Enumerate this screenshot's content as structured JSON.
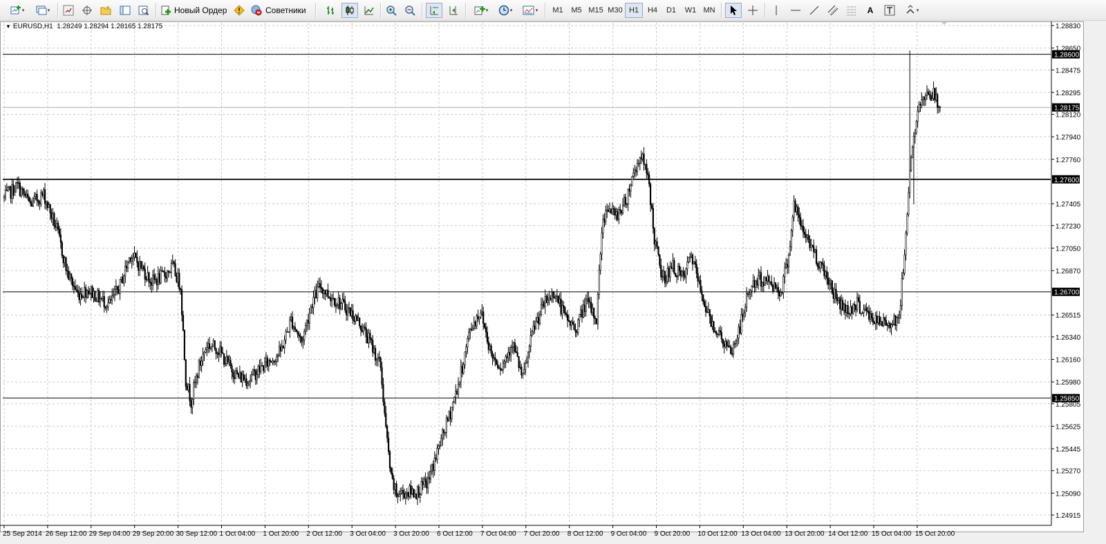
{
  "symbol_info": {
    "caret": "▼",
    "symbol": "EURUSD,H1",
    "ohlc": "1.28249 1.28294 1.28165 1.28175"
  },
  "toolbar": {
    "new_order_label": "Новый Ордер",
    "experts_label": "Советники",
    "timeframes": [
      "M1",
      "M5",
      "M15",
      "M30",
      "H1",
      "H4",
      "D1",
      "W1",
      "MN"
    ],
    "active_timeframe": "H1",
    "text_tool_label": "A",
    "dropdown_glyph": "▾"
  },
  "price_axis": {
    "ticks": [
      "1.28830",
      "1.28650",
      "1.28475",
      "1.28295",
      "1.28120",
      "1.27940",
      "1.27760",
      "1.27405",
      "1.27230",
      "1.27050",
      "1.26870",
      "1.26515",
      "1.26340",
      "1.26160",
      "1.25980",
      "1.25805",
      "1.25625",
      "1.25445",
      "1.25270",
      "1.25090",
      "1.24915"
    ],
    "labels": [
      "1.28600",
      "1.28175",
      "1.27600",
      "1.26700",
      "1.25850"
    ]
  },
  "time_axis": {
    "ticks": [
      "25 Sep 2014",
      "26 Sep 12:00",
      "29 Sep 04:00",
      "29 Sep 20:00",
      "30 Sep 12:00",
      "1 Oct 04:00",
      "1 Oct 20:00",
      "2 Oct 12:00",
      "3 Oct 04:00",
      "3 Oct 20:00",
      "6 Oct 12:00",
      "7 Oct 04:00",
      "7 Oct 20:00",
      "8 Oct 12:00",
      "9 Oct 04:00",
      "9 Oct 20:00",
      "10 Oct 12:00",
      "13 Oct 04:00",
      "13 Oct 20:00",
      "14 Oct 12:00",
      "15 Oct 04:00",
      "15 Oct 20:00"
    ]
  },
  "chart_data": {
    "type": "candlestick",
    "symbol": "EURUSD",
    "timeframe": "H1",
    "ylim": [
      1.24915,
      1.2883
    ],
    "horizontal_levels": [
      1.286,
      1.276,
      1.267,
      1.2585
    ],
    "last_price": 1.28175,
    "close_path": [
      [
        0,
        1.2745
      ],
      [
        10,
        1.2755
      ],
      [
        20,
        1.274
      ],
      [
        30,
        1.2748
      ],
      [
        40,
        1.272
      ],
      [
        48,
        1.2685
      ],
      [
        56,
        1.2668
      ],
      [
        64,
        1.2672
      ],
      [
        72,
        1.2665
      ],
      [
        80,
        1.266
      ],
      [
        88,
        1.2675
      ],
      [
        96,
        1.27
      ],
      [
        104,
        1.269
      ],
      [
        112,
        1.2678
      ],
      [
        120,
        1.2682
      ],
      [
        128,
        1.269
      ],
      [
        134,
        1.2675
      ],
      [
        138,
        1.26
      ],
      [
        142,
        1.2583
      ],
      [
        148,
        1.261
      ],
      [
        154,
        1.2628
      ],
      [
        162,
        1.2625
      ],
      [
        170,
        1.2612
      ],
      [
        178,
        1.2602
      ],
      [
        186,
        1.26
      ],
      [
        194,
        1.2608
      ],
      [
        202,
        1.2615
      ],
      [
        210,
        1.2622
      ],
      [
        218,
        1.2648
      ],
      [
        226,
        1.263
      ],
      [
        234,
        1.2662
      ],
      [
        240,
        1.2675
      ],
      [
        246,
        1.2668
      ],
      [
        254,
        1.2662
      ],
      [
        262,
        1.2655
      ],
      [
        270,
        1.2645
      ],
      [
        278,
        1.263
      ],
      [
        286,
        1.261
      ],
      [
        290,
        1.256
      ],
      [
        294,
        1.252
      ],
      [
        298,
        1.2508
      ],
      [
        306,
        1.251
      ],
      [
        314,
        1.251
      ],
      [
        322,
        1.2518
      ],
      [
        330,
        1.2545
      ],
      [
        338,
        1.257
      ],
      [
        346,
        1.26
      ],
      [
        354,
        1.264
      ],
      [
        362,
        1.2655
      ],
      [
        370,
        1.262
      ],
      [
        378,
        1.261
      ],
      [
        386,
        1.263
      ],
      [
        394,
        1.26
      ],
      [
        402,
        1.264
      ],
      [
        410,
        1.266
      ],
      [
        418,
        1.267
      ],
      [
        426,
        1.265
      ],
      [
        434,
        1.264
      ],
      [
        442,
        1.2662
      ],
      [
        450,
        1.2648
      ],
      [
        454,
        1.272
      ],
      [
        458,
        1.274
      ],
      [
        464,
        1.273
      ],
      [
        472,
        1.2742
      ],
      [
        478,
        1.2765
      ],
      [
        484,
        1.278
      ],
      [
        490,
        1.2755
      ],
      [
        494,
        1.2712
      ],
      [
        500,
        1.268
      ],
      [
        508,
        1.269
      ],
      [
        516,
        1.268
      ],
      [
        522,
        1.27
      ],
      [
        528,
        1.2675
      ],
      [
        536,
        1.2648
      ],
      [
        544,
        1.2635
      ],
      [
        552,
        1.262
      ],
      [
        558,
        1.2638
      ],
      [
        566,
        1.2672
      ],
      [
        574,
        1.268
      ],
      [
        582,
        1.2678
      ],
      [
        590,
        1.267
      ],
      [
        596,
        1.27
      ],
      [
        600,
        1.274
      ],
      [
        606,
        1.272
      ],
      [
        612,
        1.271
      ],
      [
        618,
        1.2695
      ],
      [
        624,
        1.2685
      ],
      [
        632,
        1.2665
      ],
      [
        640,
        1.2655
      ],
      [
        648,
        1.266
      ],
      [
        656,
        1.2652
      ],
      [
        664,
        1.2645
      ],
      [
        672,
        1.2645
      ],
      [
        680,
        1.265
      ],
      [
        684,
        1.27
      ],
      [
        688,
        1.277
      ],
      [
        692,
        1.28
      ],
      [
        696,
        1.282
      ],
      [
        700,
        1.283
      ],
      [
        706,
        1.2828
      ],
      [
        710,
        1.28175
      ]
    ]
  }
}
